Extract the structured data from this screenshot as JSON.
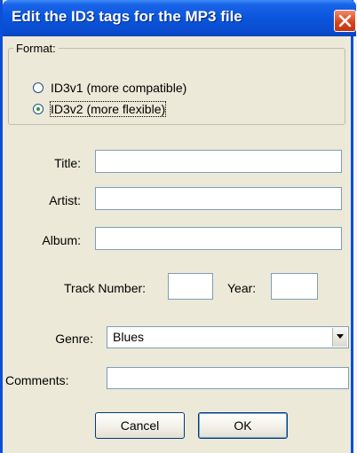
{
  "dialog": {
    "title": "Edit the ID3 tags for the MP3 file"
  },
  "format": {
    "legend": "Format:",
    "options": [
      {
        "label": "ID3v1 (more compatible)",
        "selected": false
      },
      {
        "label": "ID3v2 (more flexible)",
        "selected": true
      }
    ]
  },
  "fields": {
    "title": {
      "label": "Title:",
      "value": ""
    },
    "artist": {
      "label": "Artist:",
      "value": ""
    },
    "album": {
      "label": "Album:",
      "value": ""
    },
    "track_number": {
      "label": "Track Number:",
      "value": ""
    },
    "year": {
      "label": "Year:",
      "value": ""
    },
    "genre": {
      "label": "Genre:",
      "value": "Blues"
    },
    "comments": {
      "label": "Comments:",
      "value": ""
    }
  },
  "buttons": {
    "cancel": "Cancel",
    "ok": "OK"
  },
  "colors": {
    "titlebar": "#0a55dc",
    "dialog_bg": "#ece9d8",
    "close_button": "#d9451d"
  },
  "icons": {
    "close": "close-icon",
    "dropdown": "chevron-down-icon"
  }
}
